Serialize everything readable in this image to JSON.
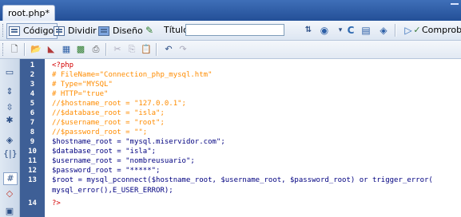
{
  "tab": {
    "title": "root.php*"
  },
  "doc_toolbar": {
    "code_label": "Código",
    "split_label": "Dividir",
    "design_label": "Diseño",
    "title_label": "Título:",
    "title_value": "",
    "validate_label": "Comprob"
  },
  "code_lines": [
    {
      "num": "1",
      "text": "<?php",
      "kind": "php"
    },
    {
      "num": "2",
      "text": "# FileName=\"Connection_php_mysql.htm\"",
      "kind": "comment"
    },
    {
      "num": "3",
      "text": "# Type=\"MYSQL\"",
      "kind": "comment"
    },
    {
      "num": "4",
      "text": "# HTTP=\"true\"",
      "kind": "comment"
    },
    {
      "num": "5",
      "text": "//$hostname_root = \"127.0.0.1\";",
      "kind": "comment"
    },
    {
      "num": "6",
      "text": "//$database_root = \"isla\";",
      "kind": "comment"
    },
    {
      "num": "7",
      "text": "//$username_root = \"root\";",
      "kind": "comment"
    },
    {
      "num": "8",
      "text": "//$password_root = \"\";",
      "kind": "comment"
    },
    {
      "num": "9",
      "text": "$hostname_root = \"mysql.miservidor.com\";",
      "kind": "normal"
    },
    {
      "num": "10",
      "text": "$database_root = \"isla\";",
      "kind": "normal"
    },
    {
      "num": "11",
      "text": "$username_root = \"nombreusuario\";",
      "kind": "normal"
    },
    {
      "num": "12",
      "text": "$password_root = \"*****\";",
      "kind": "normal"
    },
    {
      "num": "13",
      "text": "$root = mysql_pconnect($hostname_root, $username_root, $password_root) or trigger_error(",
      "kind": "normal"
    },
    {
      "num": "",
      "text": "mysql_error(),E_USER_ERROR);",
      "kind": "normal"
    },
    {
      "num": "14",
      "text": "?>",
      "kind": "php"
    }
  ],
  "colors": {
    "gutter": "#3e5f96",
    "php_tag": "#d40000",
    "comment": "#ff8c00",
    "code": "#000080"
  }
}
